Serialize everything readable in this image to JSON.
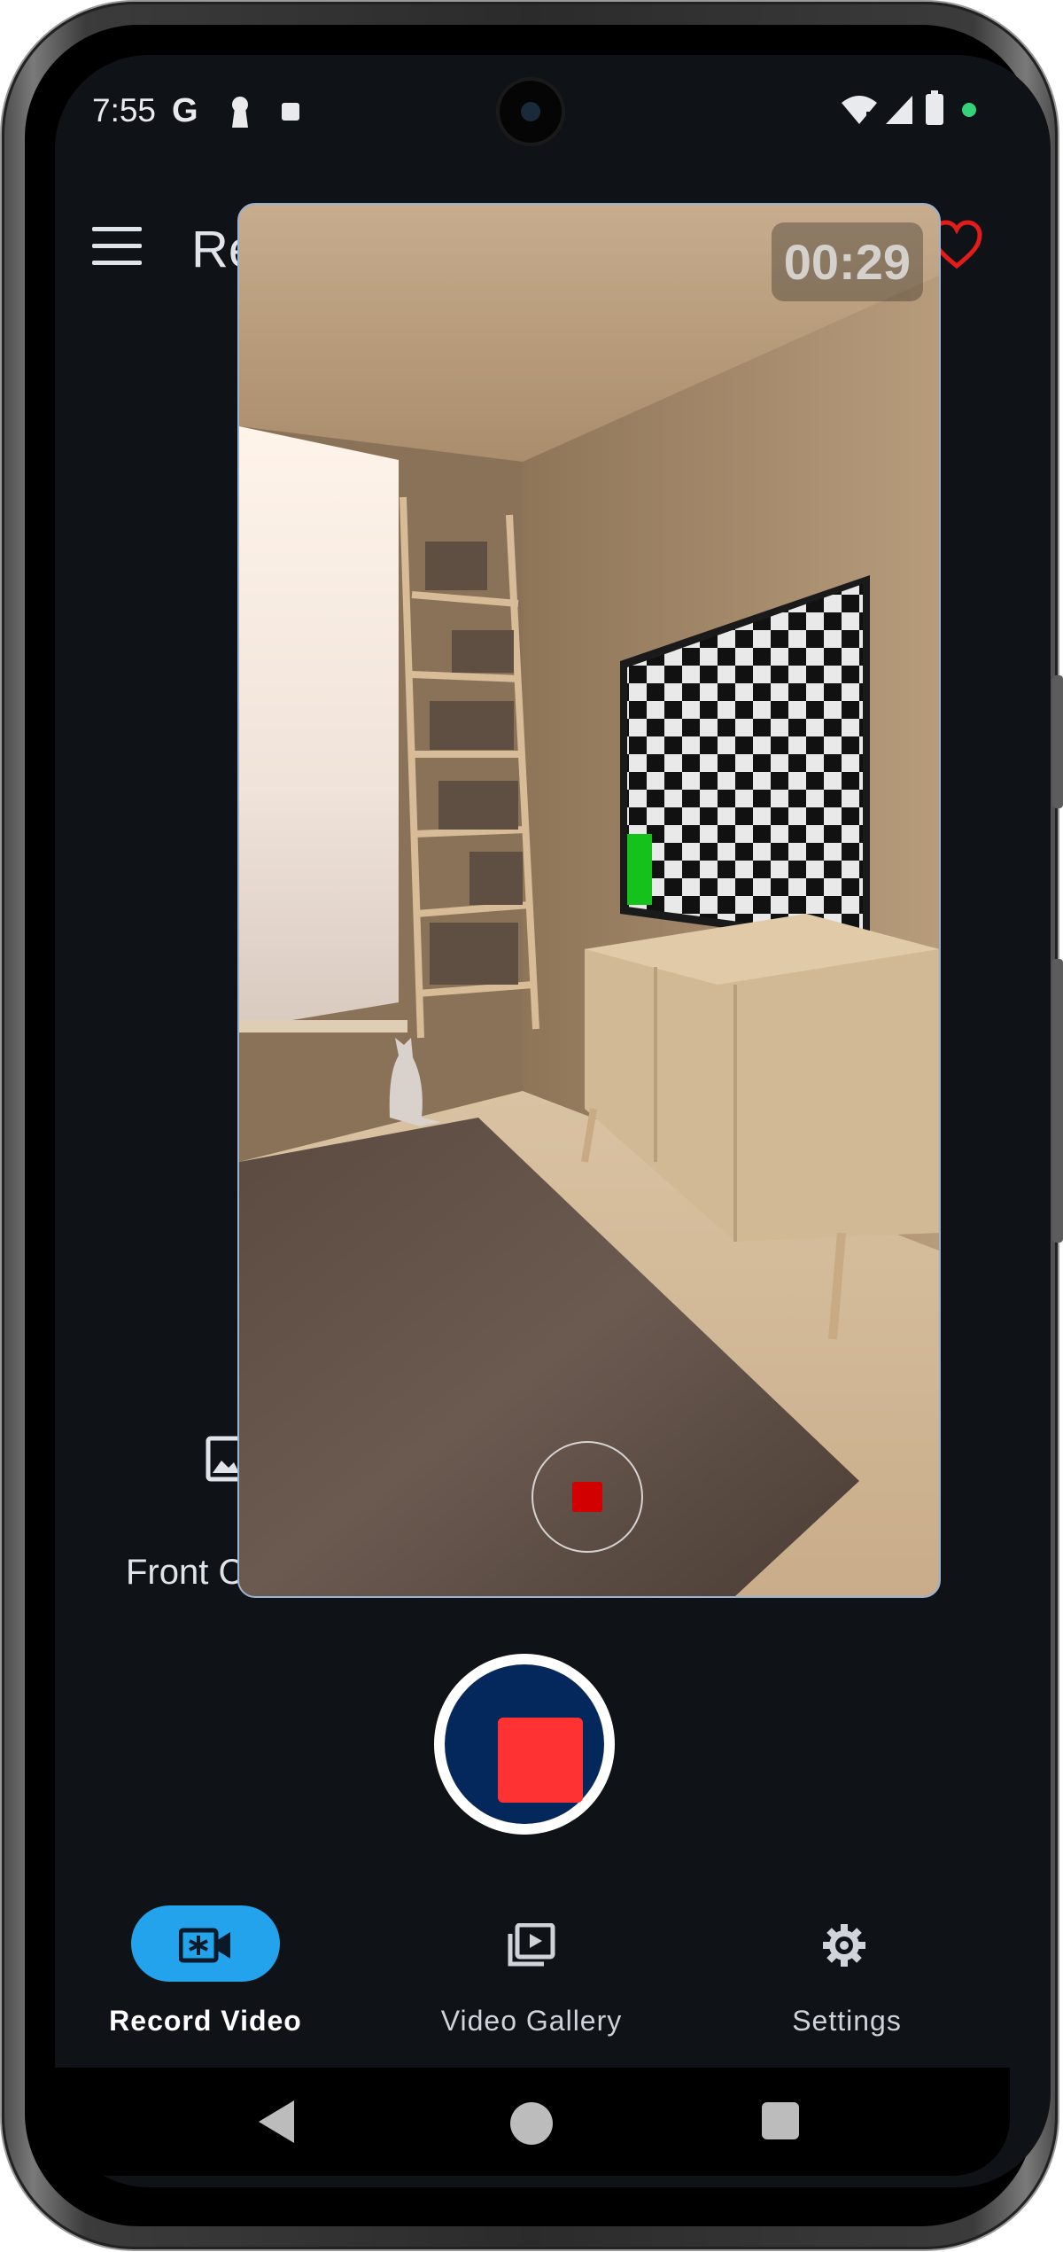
{
  "status_bar": {
    "time": "7:55",
    "left_icons": [
      "google-g-icon",
      "keyhole-icon",
      "stop-square-icon"
    ],
    "right_icons": [
      "wifi-icon",
      "signal-icon",
      "battery-icon",
      "privacy-dot-icon"
    ],
    "privacy_dot_color": "#35d27a"
  },
  "app_bar": {
    "title": "Re",
    "menu_icon": "hamburger-menu-icon",
    "favorite_icon": "heart-outline-icon",
    "favorite_color": "#e21b1b"
  },
  "background_content": {
    "front_label": "Front C"
  },
  "preview": {
    "timer": "00:29",
    "scene": "room-with-tv-camera-feed",
    "mini_record_color": "#d30000"
  },
  "record_button": {
    "state": "recording",
    "stop_color": "#ff3233",
    "ring_color": "#04285b"
  },
  "bottom_nav": {
    "items": [
      {
        "label": "Record Video",
        "icon": "video-camera-icon",
        "active": true
      },
      {
        "label": "Video Gallery",
        "icon": "video-library-icon",
        "active": false
      },
      {
        "label": "Settings",
        "icon": "gear-icon",
        "active": false
      }
    ],
    "active_pill_color": "#23a3ec"
  },
  "system_nav": {
    "buttons": [
      "back-icon",
      "home-icon",
      "recents-icon"
    ]
  }
}
